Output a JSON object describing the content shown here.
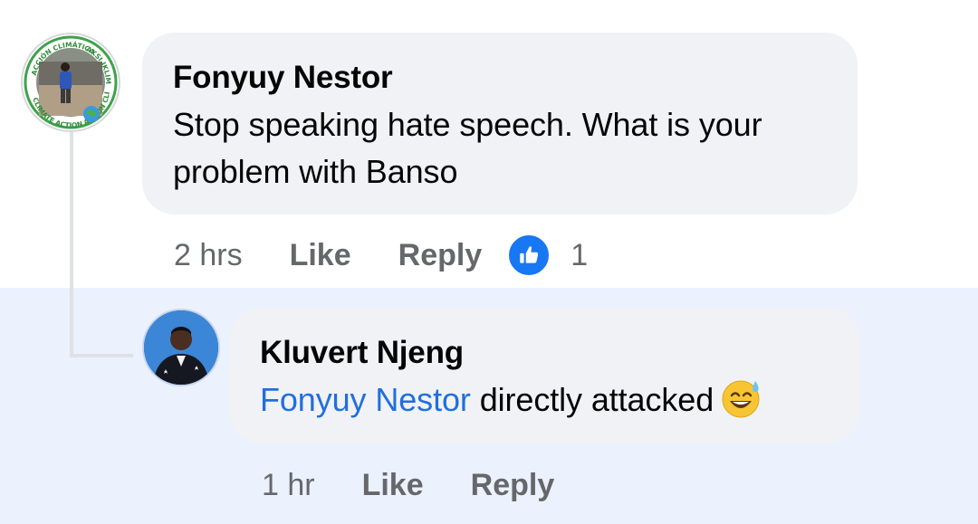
{
  "comments": [
    {
      "author": "Fonyuy Nestor",
      "text": "Stop speaking hate speech. What is your problem with Banso",
      "time": "2 hrs",
      "like_label": "Like",
      "reply_label": "Reply",
      "reaction_icon": "thumbs-up-icon",
      "reaction_count": "1",
      "avatar_badge_text": [
        "ACCIÓN CLIMÁTICA",
        "AKSI IKLIM",
        "ACTION CLIMAT",
        "CLIMATE ACTION"
      ]
    },
    {
      "author": "Kluvert Njeng",
      "mention": "Fonyuy Nestor",
      "text": " directly attacked",
      "emoji": "grinning-sweat-emoji",
      "time": "1 hr",
      "like_label": "Like",
      "reply_label": "Reply"
    }
  ],
  "colors": {
    "mention": "#216fdb",
    "reaction_blue": "#1877f2",
    "highlight_background": "#ebf1fd",
    "bubble": "#f0f2f5",
    "meta_text": "#65676b"
  }
}
